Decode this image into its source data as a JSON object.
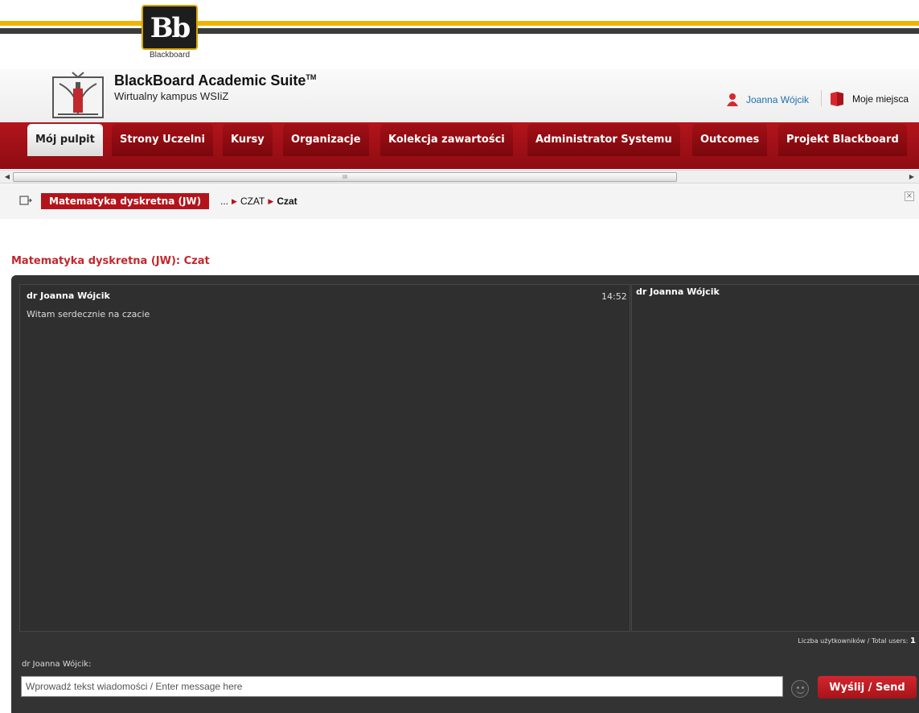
{
  "brand": {
    "logo_text": "Bb",
    "logo_caption": "Blackboard"
  },
  "header": {
    "suite_title": "BlackBoard Academic Suite",
    "trademark": "TM",
    "subtitle": "Wirtualny kampus WSIiZ",
    "user_name": "Joanna Wójcik",
    "places_label": "Moje miejsca"
  },
  "nav": {
    "tabs": [
      {
        "label": "Mój pulpit"
      },
      {
        "label": "Strony Uczelni"
      },
      {
        "label": "Kursy"
      },
      {
        "label": "Organizacje"
      },
      {
        "label": "Kolekcja zawartości"
      },
      {
        "label": "Administrator Systemu"
      },
      {
        "label": "Outcomes"
      },
      {
        "label": "Projekt Blackboard"
      }
    ]
  },
  "scrollbar": {
    "grip": "III"
  },
  "breadcrumb": {
    "course": "Matematyka dyskretna (JW)",
    "ellipsis": "...",
    "item1": "CZAT",
    "current": "Czat"
  },
  "page": {
    "title": "Matematyka dyskretna (JW): Czat"
  },
  "chat": {
    "messages": [
      {
        "author": "dr Joanna Wójcik",
        "time": "14:52",
        "text": "Witam serdecznie na czacie"
      }
    ],
    "users": [
      "dr Joanna Wójcik"
    ],
    "total_users_label": "Liczba użytkowników / Total users:",
    "total_users_count": "1",
    "compose_label": "dr Joanna Wójcik:",
    "input_placeholder": "Wprowadź tekst wiadomości / Enter message here",
    "send_label": "Wyślij / Send"
  },
  "colors": {
    "accent": "#b3141b",
    "chat_bg": "#333333",
    "title_red": "#c0282d",
    "link_blue": "#1b6fae"
  },
  "icons": [
    "crest-logo",
    "person-icon",
    "book-icon",
    "breadcrumb-icon",
    "close-icon",
    "emoticon-icon"
  ]
}
